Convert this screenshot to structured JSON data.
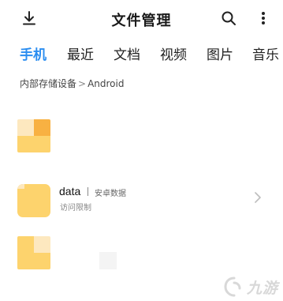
{
  "header": {
    "title": "文件管理",
    "download_icon": "download-icon",
    "search_icon": "search-icon",
    "more_icon": "more-vertical-icon"
  },
  "tabs": [
    {
      "label": "手机",
      "active": true
    },
    {
      "label": "最近",
      "active": false
    },
    {
      "label": "文档",
      "active": false
    },
    {
      "label": "视频",
      "active": false
    },
    {
      "label": "图片",
      "active": false
    },
    {
      "label": "音乐",
      "active": false
    }
  ],
  "breadcrumb": {
    "root": "内部存储设备",
    "separator": ">",
    "current": "Android"
  },
  "files": [
    {
      "name": "",
      "meta": "",
      "sub": ""
    },
    {
      "name": "data",
      "meta": "安卓数据",
      "sub": "访问限制"
    },
    {
      "name": "",
      "meta": "",
      "sub": ""
    }
  ],
  "watermark": {
    "text": "九游"
  },
  "colors": {
    "accent": "#2a8df0",
    "folder": "#fdd36d",
    "folder_dark": "#f8b142",
    "folder_light": "#fde8bf"
  }
}
